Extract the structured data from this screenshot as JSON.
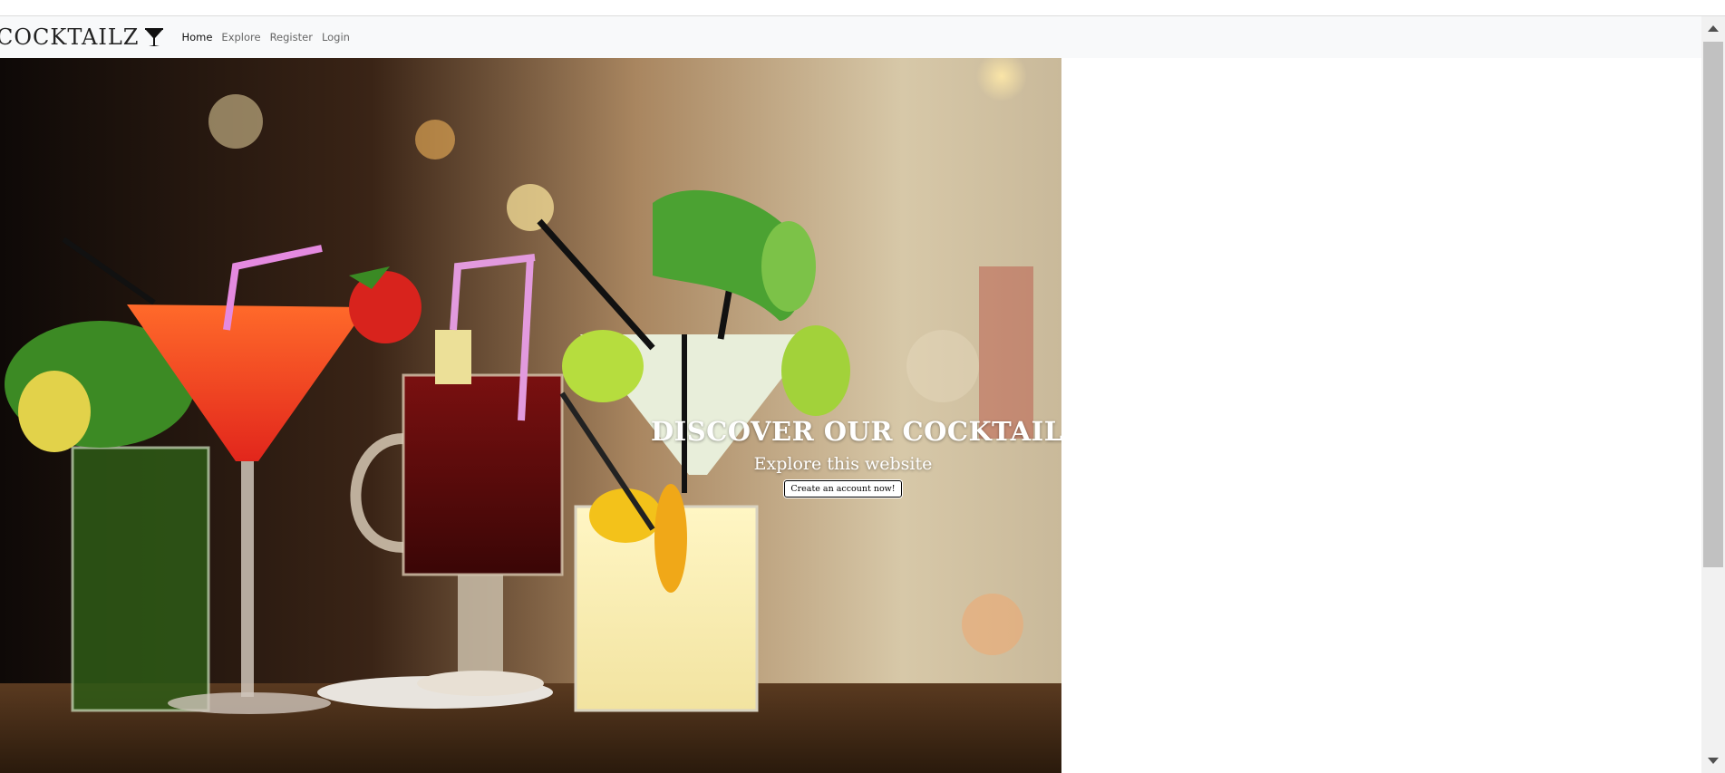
{
  "navbar": {
    "brand": "COCKTAILZ",
    "brand_icon": "cocktail-glass-icon",
    "links": [
      {
        "label": "Home",
        "active": true
      },
      {
        "label": "Explore",
        "active": false
      },
      {
        "label": "Register",
        "active": false
      },
      {
        "label": "Login",
        "active": false
      }
    ]
  },
  "hero": {
    "title": "DISCOVER OUR COCKTAILZ",
    "subtitle": "Explore this website",
    "button_label": "Create an account now!"
  },
  "colors": {
    "navbar_bg": "#f8f9fa",
    "text_dark": "#222222",
    "text_muted": "#666666",
    "hero_text": "#ffffff"
  }
}
